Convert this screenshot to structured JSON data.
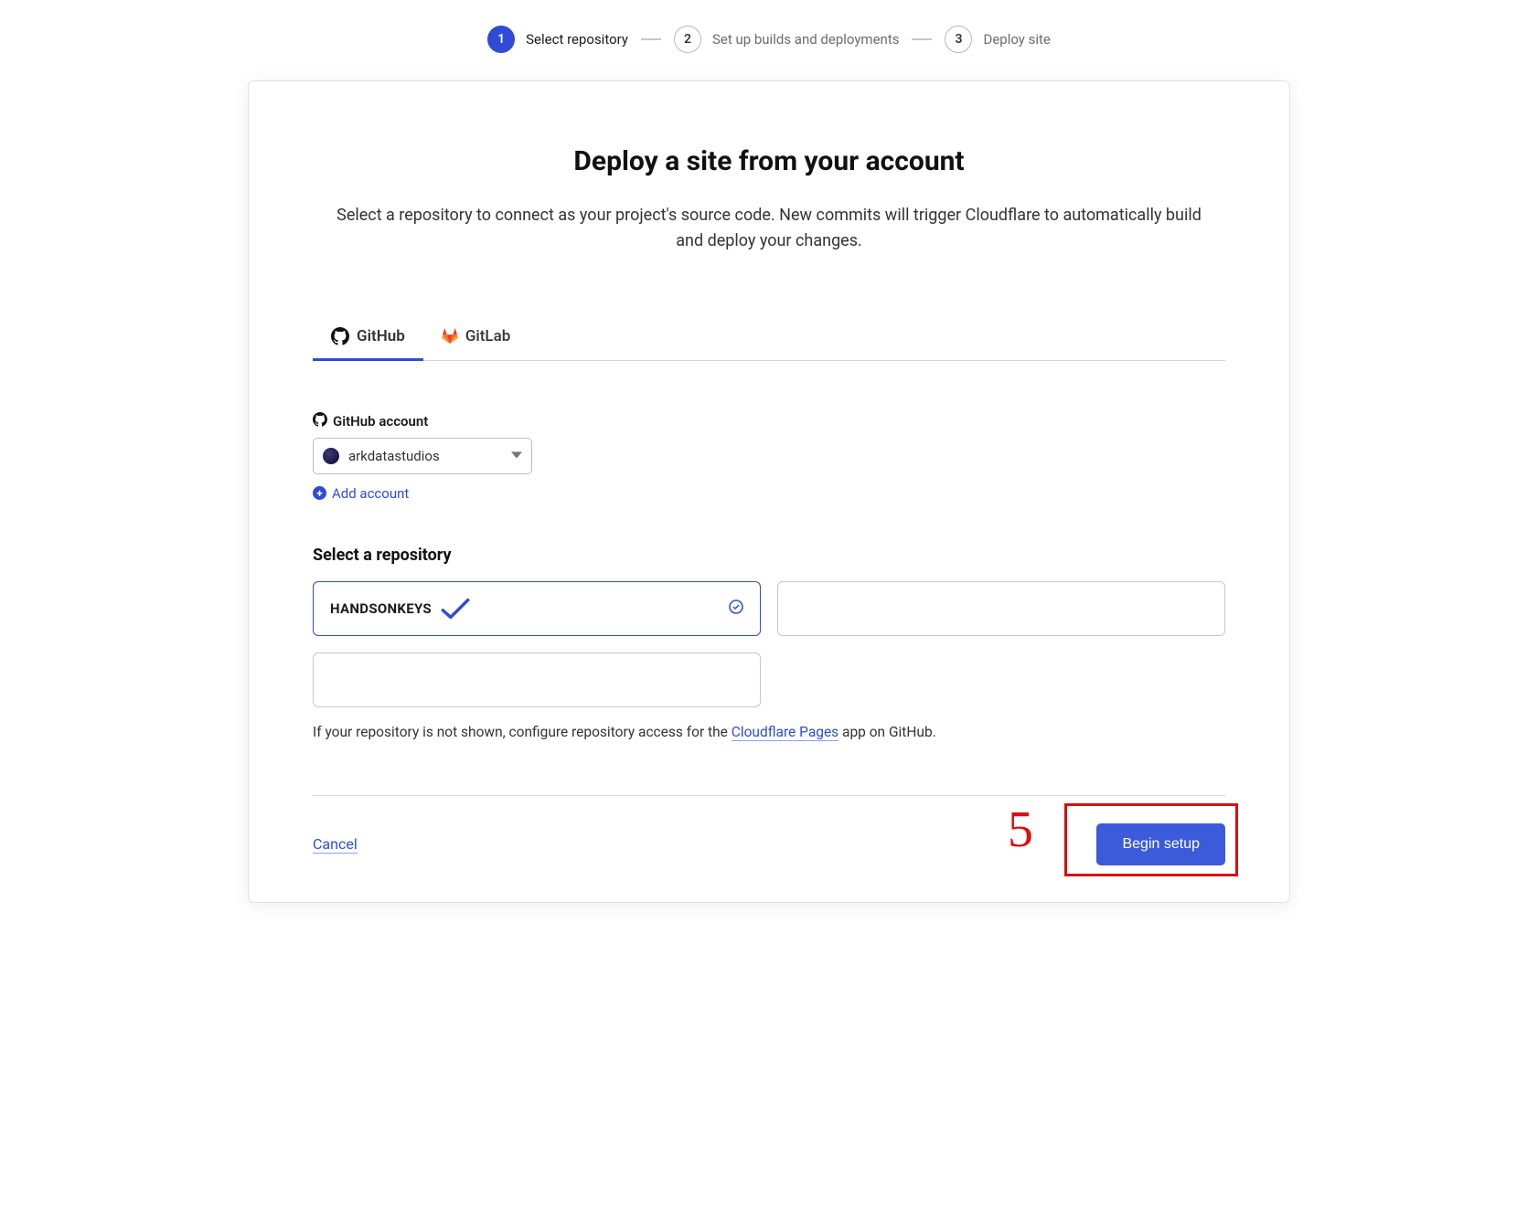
{
  "stepper": {
    "steps": [
      {
        "num": "1",
        "label": "Select repository",
        "active": true
      },
      {
        "num": "2",
        "label": "Set up builds and deployments",
        "active": false
      },
      {
        "num": "3",
        "label": "Deploy site",
        "active": false
      }
    ]
  },
  "header": {
    "title": "Deploy a site from your account",
    "subtitle": "Select a repository to connect as your project's source code. New commits will trigger Cloudflare to automatically build and deploy your changes."
  },
  "tabs": {
    "github": "GitHub",
    "gitlab": "GitLab"
  },
  "account": {
    "label": "GitHub account",
    "selected": "arkdatastudios",
    "add_label": "Add account"
  },
  "repos": {
    "heading": "Select a repository",
    "items": [
      {
        "name": "HANDSONKEYS",
        "selected": true
      },
      {
        "name": "",
        "selected": false
      },
      {
        "name": "",
        "selected": false
      }
    ],
    "help_prefix": "If your repository is not shown, configure repository access for the ",
    "help_link": "Cloudflare Pages",
    "help_suffix": " app on GitHub."
  },
  "footer": {
    "cancel": "Cancel",
    "begin": "Begin setup"
  },
  "annotations": {
    "step_number": "5"
  }
}
